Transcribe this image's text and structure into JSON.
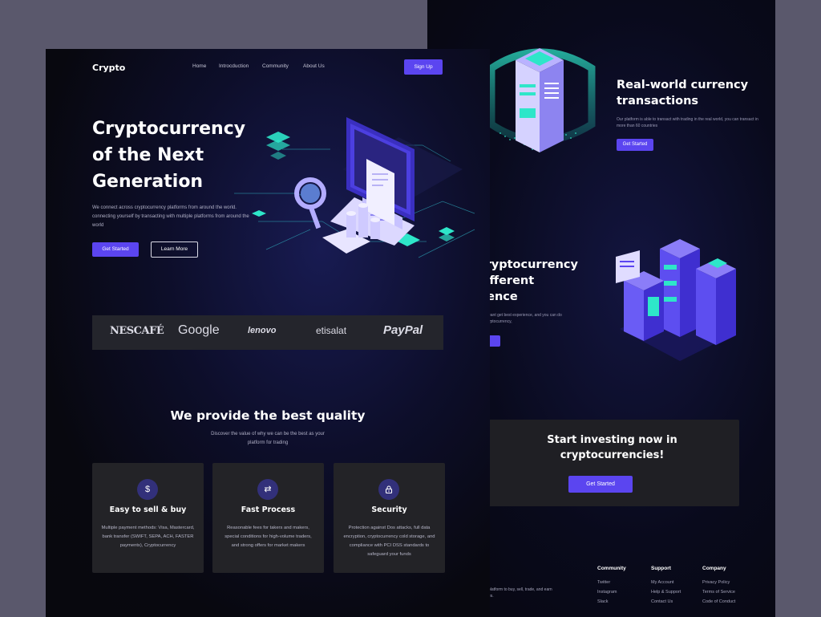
{
  "back": {
    "section1": {
      "title": "Real-world currency transactions",
      "text": "Our platform is able to transact with trading in the real world, you can transact in more than 60 countries",
      "button": "Get Started"
    },
    "section2": {
      "title_lines": [
        "Cryptocurrency",
        "different",
        "rience"
      ],
      "text_lines": [
        "eant get best experience, and you can do",
        "yptocurrency,"
      ],
      "button": "d"
    },
    "cta": {
      "title_lines": [
        "Start investing now in",
        "cryptocurrencies!"
      ],
      "button": "Get Started"
    },
    "footer": {
      "desc_lines": [
        "platform to buy, sell, trade, and earn",
        "es."
      ],
      "columns": [
        {
          "title": "Community",
          "links": [
            "Twitter",
            "Instagram",
            "Slack"
          ]
        },
        {
          "title": "Support",
          "links": [
            "My Account",
            "Help & Support",
            "Contact Us"
          ]
        },
        {
          "title": "Company",
          "links": [
            "Privacy Policy",
            "Terms of Service",
            "Code of Conduct"
          ]
        }
      ]
    }
  },
  "front": {
    "logo": "Crypto",
    "nav": [
      "Home",
      "Introcduction",
      "Community",
      "About Us"
    ],
    "signup": "Sign Up",
    "hero": {
      "title_lines": [
        "Cryptocurrency",
        "of the Next",
        "Generation"
      ],
      "text": "We connect across cryptocurrency platforms from around the world. connecting yourself by transacting with multiple platforms from around the world",
      "primary": "Get Started",
      "secondary": "Learn More"
    },
    "brands": [
      "NESCAFÉ",
      "Google",
      "lenovo",
      "etisalat",
      "PayPal"
    ],
    "quality": {
      "title": "We provide the best quality",
      "subtitle": "Discover the value of why we can be the best as your platform for trading"
    },
    "cards": [
      {
        "icon": "dollar-icon",
        "title": "Easy to sell & buy",
        "text": "Multiple payment methods: Visa, Mastercard, bank transfer (SWIFT, SEPA, ACH, FASTER payments), Cryptocurrency"
      },
      {
        "icon": "swap-icon",
        "title": "Fast Process",
        "text": "Reasonable fees for takers and makers, special conditions for high-volume traders, and strong offers for market makers"
      },
      {
        "icon": "lock-icon",
        "title": "Security",
        "text": "Protection against Dos attacks, full data encryption, cryptocurrency cold storage, and compliance with PCI DSS standards to safeguard your funds"
      }
    ],
    "colors": {
      "accent": "#5b45f0",
      "card": "#232327",
      "teal": "#2ee6c9"
    }
  }
}
